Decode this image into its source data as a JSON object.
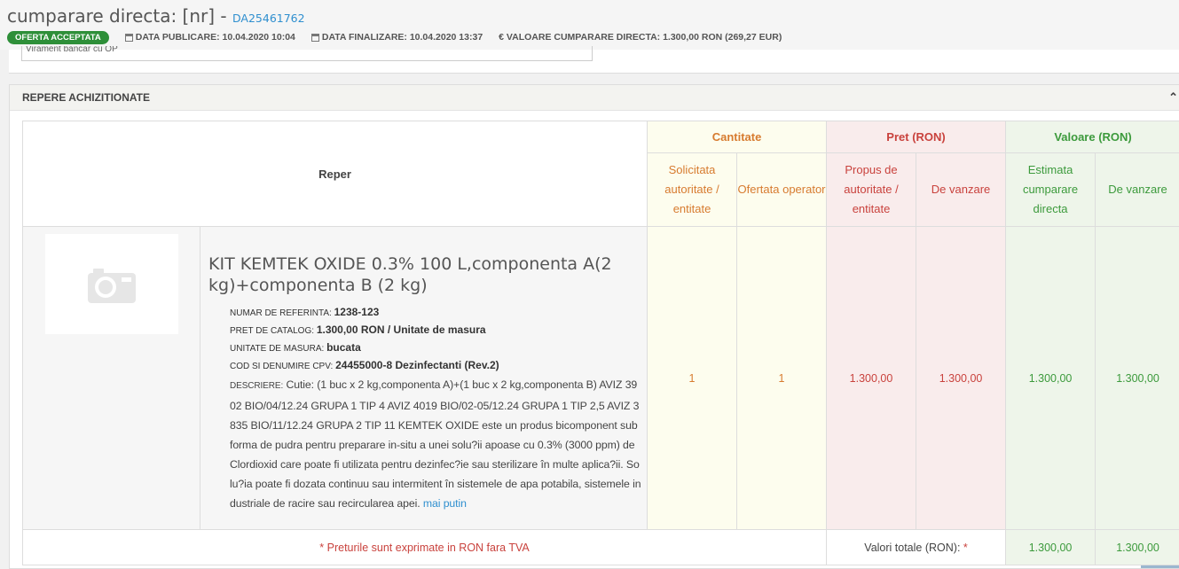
{
  "header": {
    "title_prefix": "cumparare directa: [nr] - ",
    "title_number": "DA25461762",
    "badge": "OFERTA ACCEPTATA",
    "data_publicare": "DATA PUBLICARE: 10.04.2020 10:04",
    "data_finalizare": "DATA FINALIZARE: 10.04.2020 13:37",
    "valoare": "€ VALOARE CUMPARARE DIRECTA: 1.300,00  RON (269,27  EUR)"
  },
  "top_card": {
    "field_text": "Virament bancar cu OP"
  },
  "panel": {
    "title": "REPERE ACHIZITIONATE"
  },
  "table": {
    "col_reper": "Reper",
    "group_cantitate": "Cantitate",
    "group_pret": "Pret (RON)",
    "group_valoare": "Valoare (RON)",
    "sub_solicitata": "Solicitata autoritate / entitate",
    "sub_ofertata": "Ofertata operator",
    "sub_propus": "Propus de autoritate / entitate",
    "sub_pret_vanzare": "De vanzare",
    "sub_estimata": "Estimata cumparare directa",
    "sub_val_vanzare": "De vanzare"
  },
  "item": {
    "name": "KIT KEMTEK OXIDE 0.3% 100 L,componenta A(2 kg)+componenta B (2 kg)",
    "ref_label": "NUMAR DE REFERINTA:",
    "ref_value": "1238-123",
    "catalog_label": "PRET DE CATALOG:",
    "catalog_value": "1.300,00  RON / Unitate de masura",
    "unit_label": "UNITATE DE MASURA:",
    "unit_value": "bucata",
    "cpv_label": "COD SI DENUMIRE CPV:",
    "cpv_value": "24455000-8 Dezinfectanti (Rev.2)",
    "desc_label": "DESCRIERE:",
    "desc_text": "Cutie: (1 buc x 2 kg,componenta A)+(1 buc x 2 kg,componenta B) AVIZ 3902 BIO/04/12.24 GRUPA 1 TIP 4 AVIZ 4019 BIO/02-05/12.24 GRUPA 1 TIP 2,5 AVIZ 3835 BIO/11/12.24 GRUPA 2 TIP 11 KEMTEK OXIDE este un produs bicomponent sub forma de pudra pentru preparare in-situ a unei solu?ii apoase cu 0.3% (3000 ppm) de Clordioxid care poate fi utilizata pentru dezinfec?ie sau sterilizare în multe aplica?ii. Solu?ia poate fi dozata continuu sau intermitent în sistemele de apa potabila, sistemele industriale de racire sau recircularea apei.",
    "desc_link": "mai putin",
    "qty_solicitata": "1",
    "qty_ofertata": "1",
    "pret_propus": "1.300,00",
    "pret_vanzare": "1.300,00",
    "val_estimata": "1.300,00",
    "val_vanzare": "1.300,00"
  },
  "footer": {
    "note": "* Preturile sunt exprimate in RON fara TVA",
    "totals_label": "Valori totale (RON):",
    "totals_star": " *",
    "total_estimata": "1.300,00",
    "total_vanzare": "1.300,00"
  },
  "colors": {
    "link": "#2f8fcf",
    "badge": "#2e8f39",
    "cantitate": "#d77b2f",
    "pret": "#c9423d",
    "valoare": "#3c9a3c"
  },
  "icons": {
    "calendar": "calendar-icon",
    "camera": "camera-icon",
    "collapse": "chevron-up-icon"
  }
}
